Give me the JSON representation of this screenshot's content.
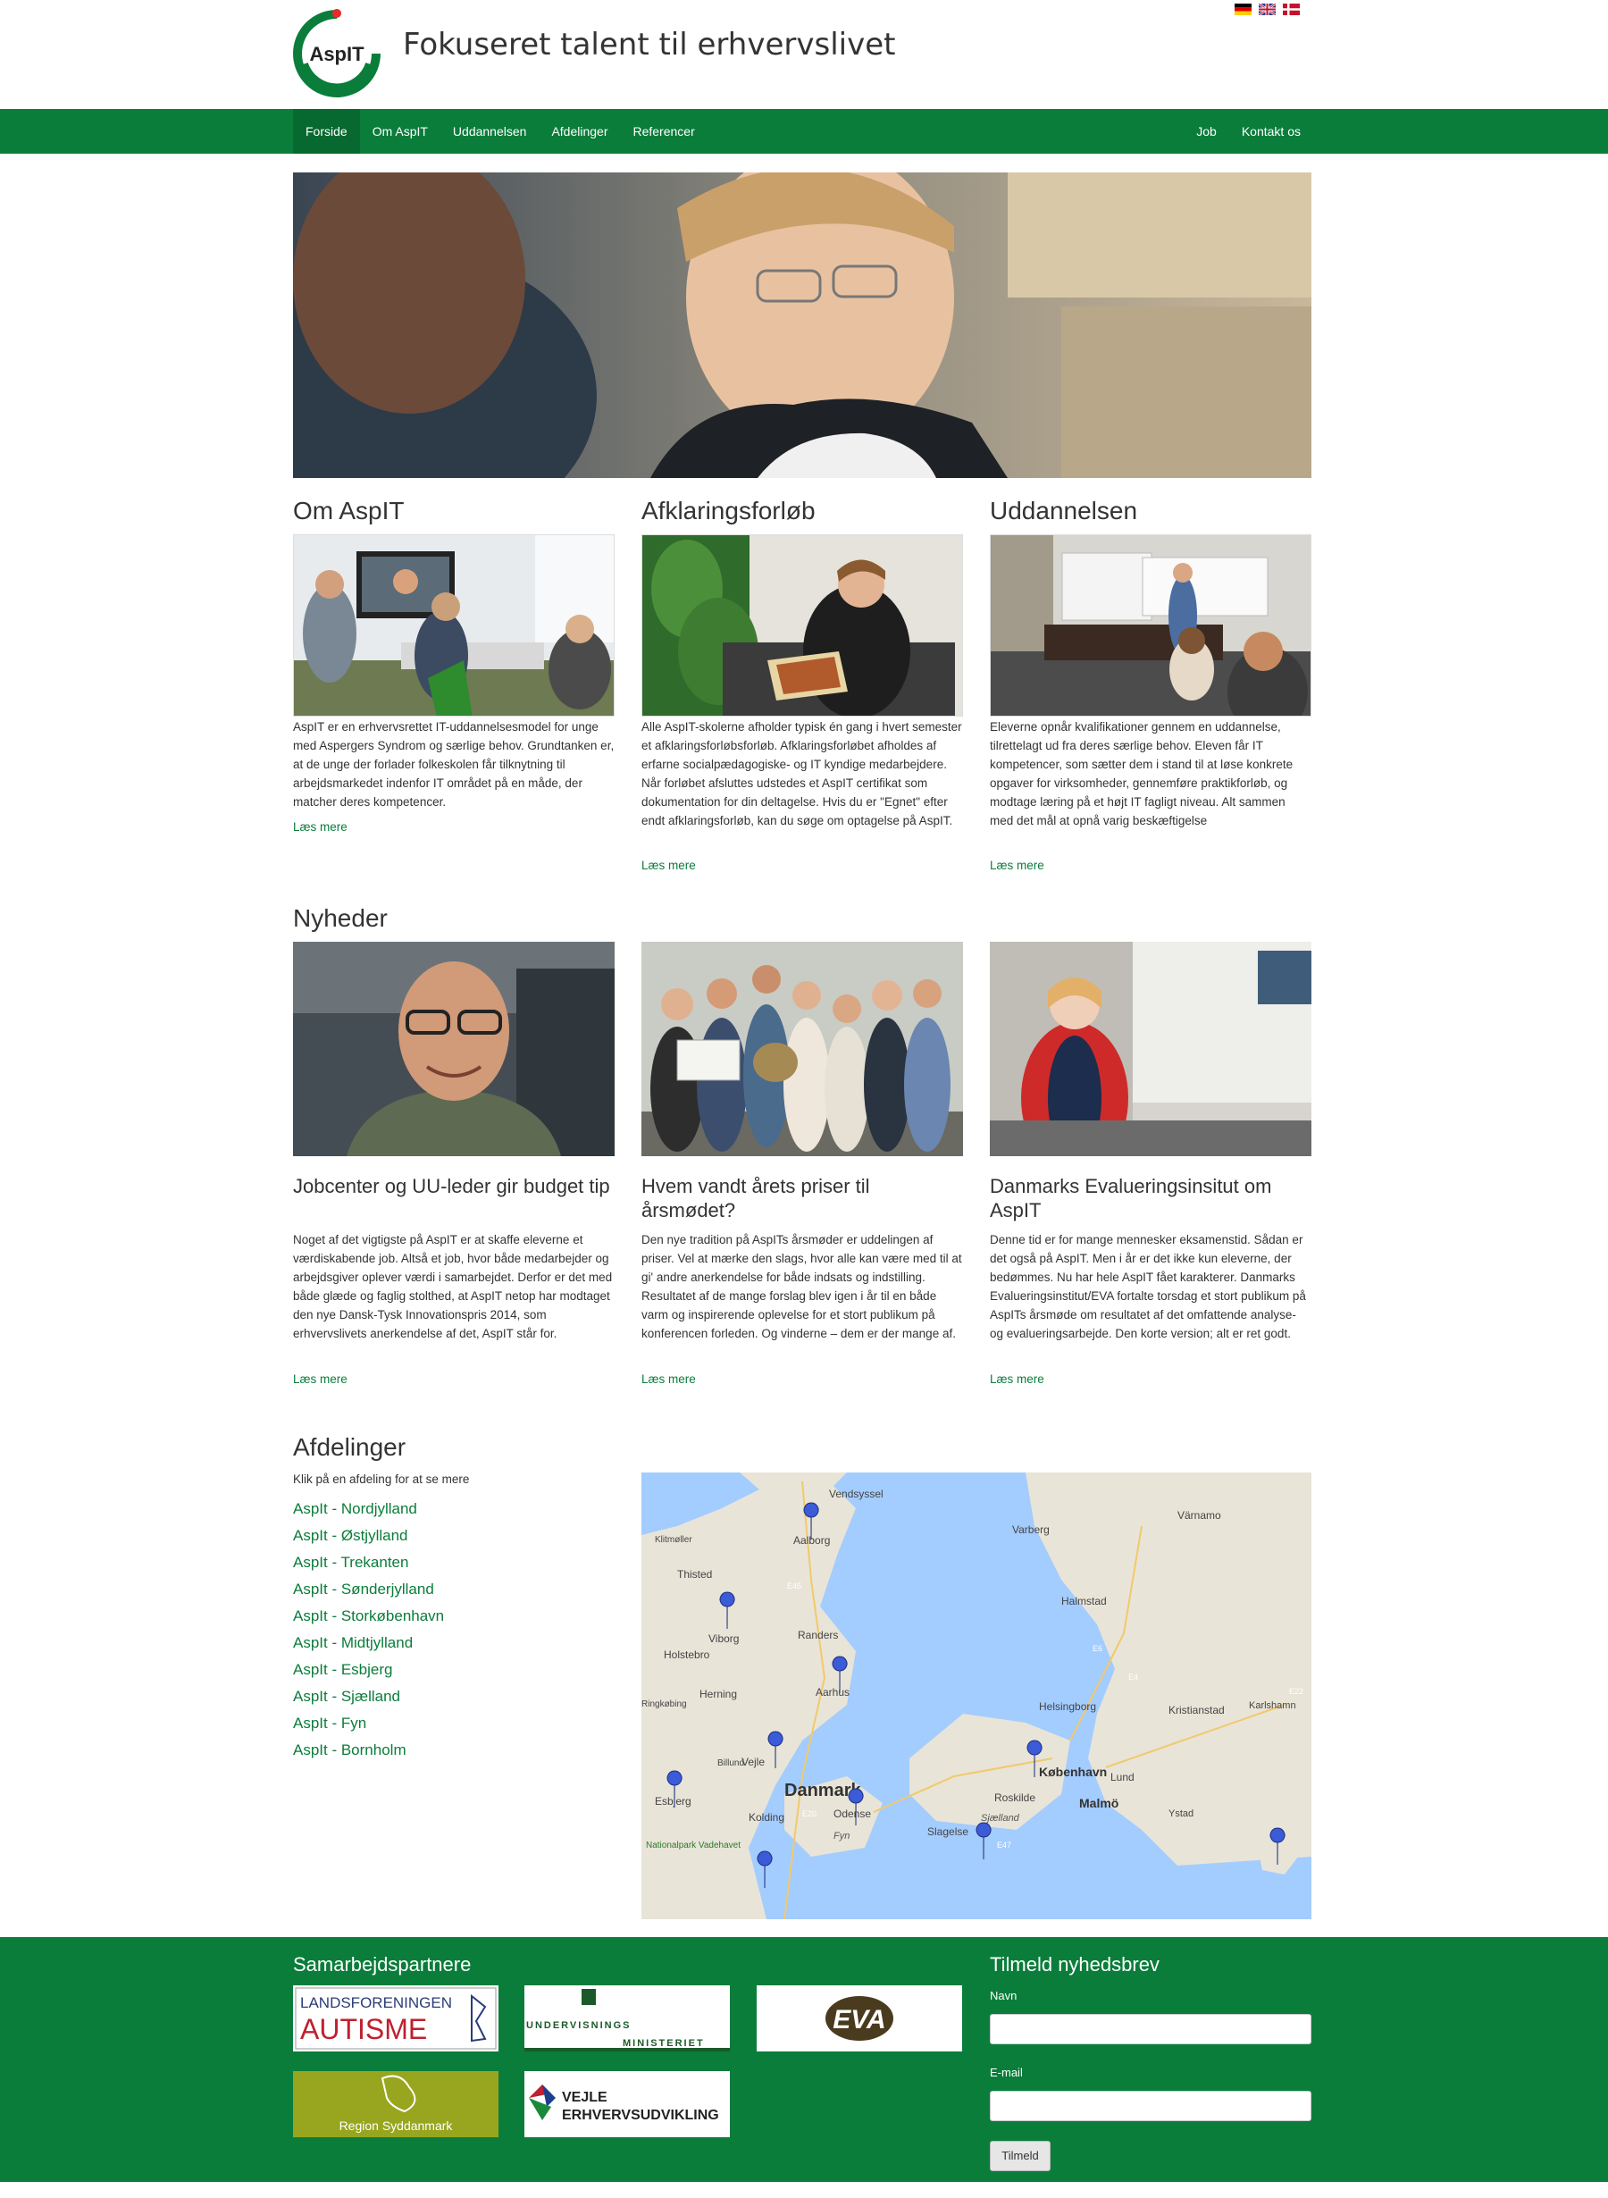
{
  "header": {
    "logo_text": "AspIT",
    "tagline": "Fokuseret talent til erhvervslivet",
    "languages": [
      "Deutsch",
      "English",
      "Dansk"
    ]
  },
  "nav": {
    "left": [
      "Forside",
      "Om AspIT",
      "Uddannelsen",
      "Afdelinger",
      "Referencer"
    ],
    "right": [
      "Job",
      "Kontakt os"
    ]
  },
  "intro": {
    "om": {
      "title": "Om AspIT",
      "text": "AspIT er en erhvervsrettet IT-uddannelsesmodel for unge med Aspergers Syndrom og særlige behov. Grundtanken er, at de unge der forlader folkeskolen får tilknytning til arbejdsmarkedet indenfor IT området på en måde, der matcher deres kompetencer.",
      "more": "Læs mere"
    },
    "afklaring": {
      "title": "Afklaringsforløb",
      "text": "Alle AspIT-skolerne afholder typisk én gang i hvert semester et afklaringsforløbsforløb. Afklaringsforløbet afholdes af erfarne socialpædagogiske- og IT kyndige medarbejdere. Når forløbet afsluttes udstedes et AspIT certifikat som dokumentation for din deltagelse. Hvis du er \"Egnet\" efter endt afklaringsforløb, kan du søge om optagelse på AspIT.",
      "more": "Læs mere"
    },
    "uddannelsen": {
      "title": "Uddannelsen",
      "text": "Eleverne opnår kvalifikationer gennem en uddannelse, tilrettelagt ud fra deres særlige behov. Eleven får IT kompetencer, som sætter dem i stand til at løse konkrete opgaver for virksomheder, gennemføre praktikforløb, og modtage læring på et højt IT fagligt niveau. Alt sammen med det mål at opnå varig beskæftigelse",
      "more": "Læs mere"
    }
  },
  "news": {
    "title": "Nyheder",
    "items": [
      {
        "title": "Jobcenter og UU-leder gir budget tip",
        "text": "Noget af det vigtigste på AspIT er at skaffe eleverne et værdiskabende job. Altså et job, hvor både medarbejder og arbejdsgiver oplever værdi i samarbejdet. Derfor er det med både glæde og faglig stolthed, at AspIT netop har modtaget den nye Dansk-Tysk Innovationspris 2014, som erhvervslivets anerkendelse af det, AspIT står for.",
        "more": "Læs mere"
      },
      {
        "title": "Hvem vandt årets priser til årsmødet?",
        "text": "Den nye tradition på AspITs årsmøder er uddelingen af priser. Vel at mærke den slags, hvor alle kan være med til at gi' andre anerkendelse for både indsats og indstilling. Resultatet af de mange forslag blev igen i år til en både varm og inspirerende oplevelse for et stort publikum på konferencen forleden. Og vinderne – dem er der mange af.",
        "more": "Læs mere"
      },
      {
        "title": "Danmarks Evalueringsinsitut om AspIT",
        "text": "Denne tid er for mange mennesker eksamenstid. Sådan er det også på AspIT. Men i år er det ikke kun eleverne, der bedømmes. Nu har hele AspIT fået karakterer. Danmarks Evalueringsinstitut/EVA fortalte torsdag et stort publikum på AspITs årsmøde om resultatet af det omfattende analyse- og evalueringsarbejde. Den korte version; alt er ret godt.",
        "more": "Læs mere"
      }
    ]
  },
  "afdelinger": {
    "title": "Afdelinger",
    "subtitle": "Klik på en afdeling for at se mere",
    "links": [
      "AspIt - Nordjylland",
      "AspIt - Østjylland",
      "AspIt - Trekanten",
      "AspIt - Sønderjylland",
      "AspIt - Storkøbenhavn",
      "AspIt - Midtjylland",
      "AspIt - Esbjerg",
      "AspIt - Sjælland",
      "AspIt - Fyn",
      "AspIt - Bornholm"
    ],
    "map_labels": {
      "vendsyssel": "Vendsyssel",
      "aalborg": "Aalborg",
      "thisted": "Thisted",
      "viborg": "Viborg",
      "randers": "Randers",
      "holstebro": "Holstebro",
      "herning": "Herning",
      "aarhus": "Aarhus",
      "billund": "Billund",
      "vejle": "Vejle",
      "danmark": "Danmark",
      "esbjerg": "Esbjerg",
      "kolding": "Kolding",
      "odense": "Odense",
      "fyn": "Fyn",
      "slagelse": "Slagelse",
      "sjaelland": "Sjælland",
      "roskilde": "Roskilde",
      "kobenhavn": "København",
      "malmo": "Malmö",
      "lund": "Lund",
      "helsingborg": "Helsingborg",
      "halmstad": "Halmstad",
      "varberg": "Varberg",
      "varnamo": "Värnamo",
      "kristianstad": "Kristianstad",
      "karlshamn": "Karlshamn",
      "ystad": "Ystad",
      "vadehavet": "Nationalpark Vadehavet",
      "klitmoller": "Klitmøller",
      "ringkobing": "Ringkøbing",
      "e45": "E45",
      "e6": "E6",
      "e4": "E4",
      "e20": "E20",
      "e47": "E47",
      "e22": "E22"
    }
  },
  "footer": {
    "partners_title": "Samarbejdspartnere",
    "partners": [
      {
        "top": "LANDSFORENINGEN",
        "bottom": "AUTISME"
      },
      {
        "top": "UNDERVISNINGS",
        "bottom": "MINISTERIET"
      },
      {
        "top": "EVA",
        "bottom": ""
      },
      {
        "top": "Region Syddanmark",
        "bottom": ""
      },
      {
        "top": "VEJLE",
        "bottom": "ERHVERVSUDVIKLING"
      }
    ],
    "newsletter": {
      "title": "Tilmeld nyhedsbrev",
      "name_label": "Navn",
      "email_label": "E-mail",
      "button": "Tilmeld"
    }
  },
  "colors": {
    "brand_green": "#0a7d3a",
    "link_green": "#0a7d3a",
    "logo_red": "#e52b2b"
  }
}
